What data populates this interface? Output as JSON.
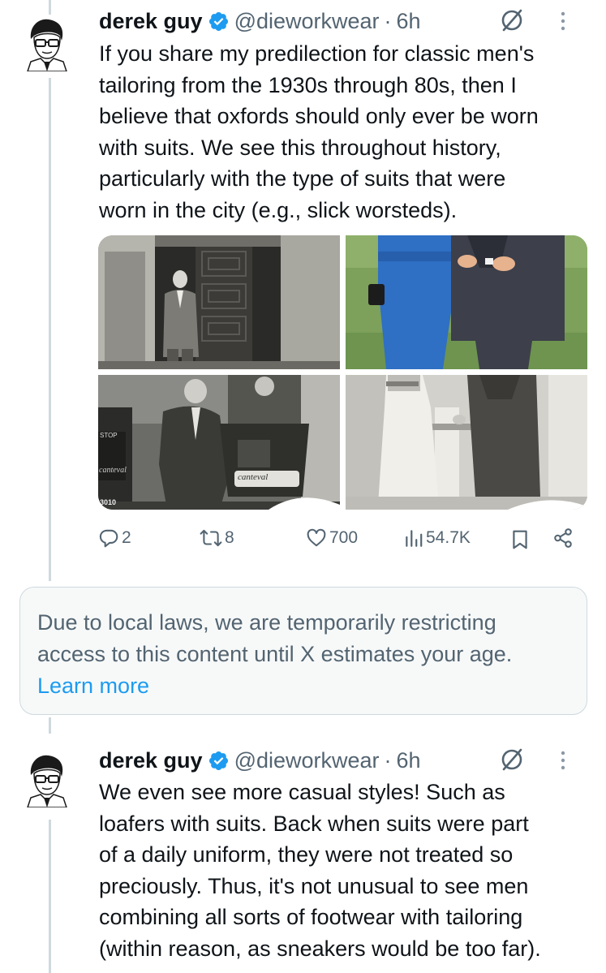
{
  "tweets": [
    {
      "author": {
        "name": "derek guy",
        "handle": "@dieworkwear",
        "time": "6h"
      },
      "text": "If you share my predilection for classic men's\ntailoring from the 1930s through 80s, then I\nbelieve that oxfords should only ever be worn\nwith suits. We see this throughout history,\nparticularly with the type of suits that were\nworn in the city (e.g., slick worsteds).",
      "media": {
        "sign_text_1": "STOP",
        "sign_text_2": "canteval",
        "sign_text_3": "canteval",
        "sign_text_4": "3010"
      },
      "stats": {
        "replies": "2",
        "reposts": "8",
        "likes": "700",
        "views": "54.7K"
      }
    },
    {
      "author": {
        "name": "derek guy",
        "handle": "@dieworkwear",
        "time": "6h"
      },
      "text": "We even see more casual styles! Such as\nloafers with suits. Back when suits were part\nof a daily uniform, they were not treated so\npreciously. Thus, it's not unusual to see men\ncombining all sorts of footwear with tailoring\n(within reason, as sneakers would be too far)."
    }
  ],
  "notice": {
    "text": "Due to local laws, we are temporarily restricting\naccess to this content until X estimates your age.",
    "link": "Learn more"
  },
  "separator": "·",
  "colors": {
    "text": "#0f1419",
    "secondary": "#536471",
    "link": "#1d9bf0",
    "verified": "#1d9bf0",
    "notice_bg": "#f7f9f9",
    "border": "#cfd9de"
  },
  "icons": {
    "verified": "verified-badge-icon",
    "grok": "grok-icon",
    "more": "more-vertical-icon",
    "reply": "reply-icon",
    "repost": "repost-icon",
    "like": "heart-icon",
    "views": "views-chart-icon",
    "bookmark": "bookmark-icon",
    "share": "share-icon"
  }
}
